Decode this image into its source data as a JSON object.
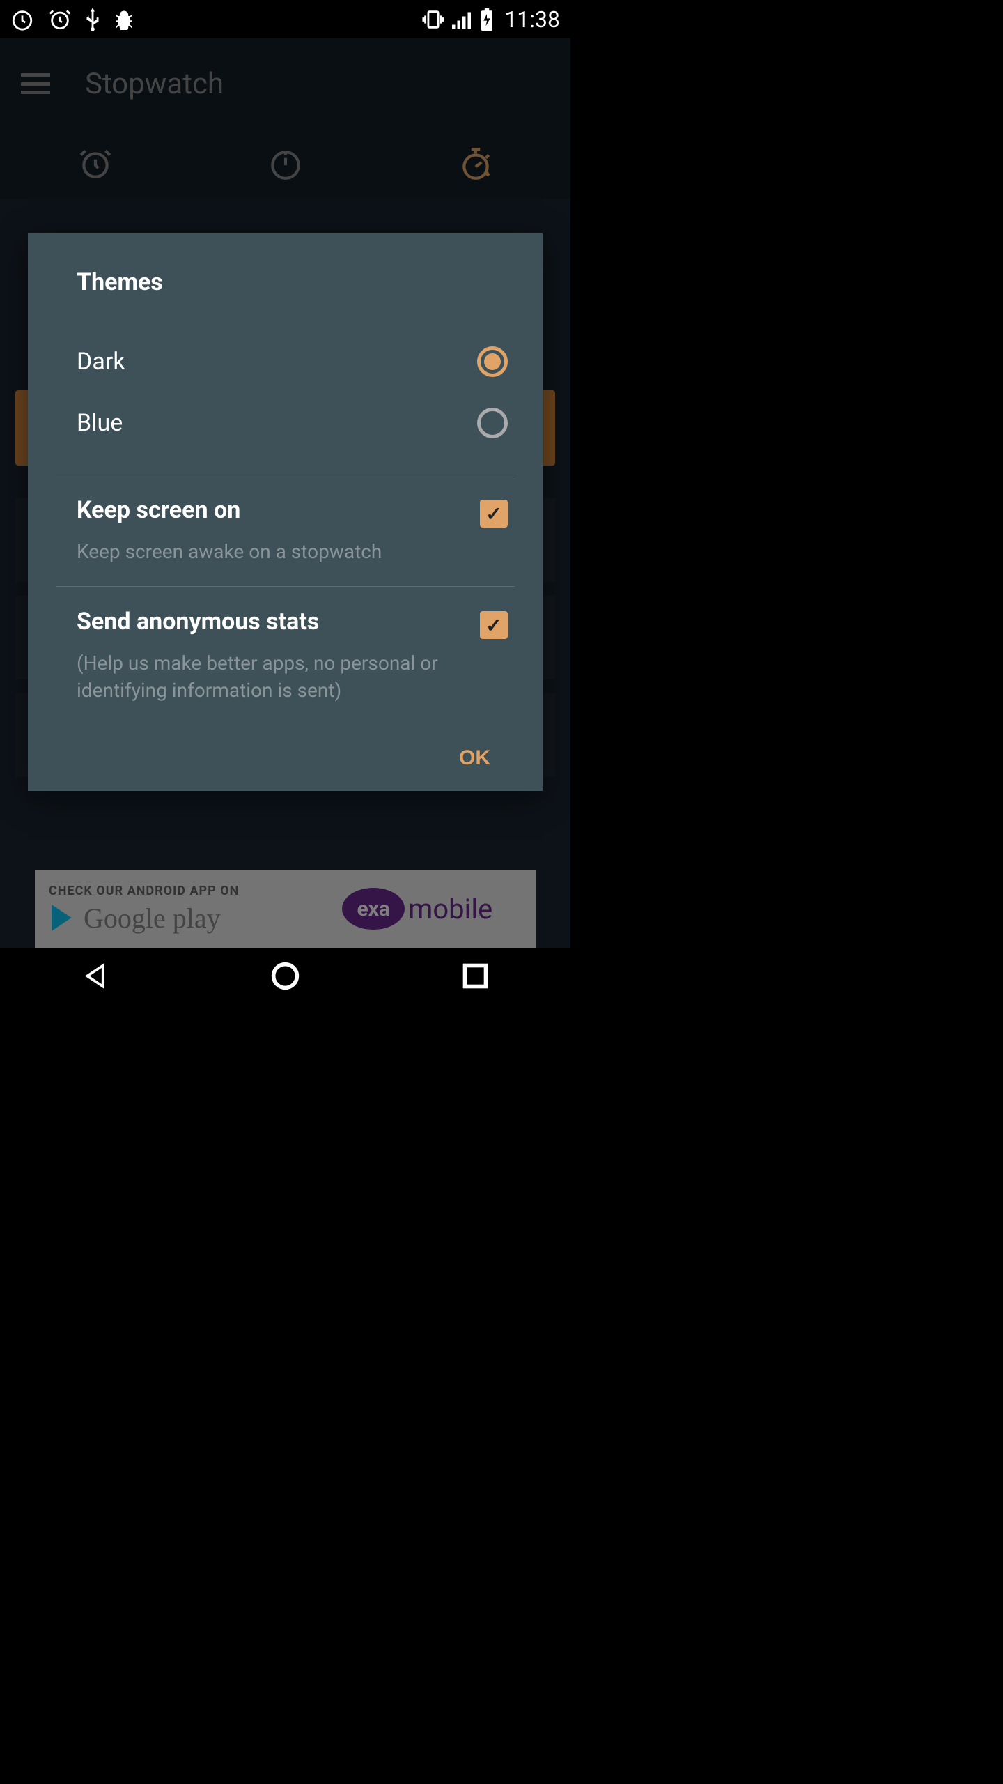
{
  "status_bar": {
    "time": "11:38"
  },
  "app": {
    "title": "Stopwatch"
  },
  "dialog": {
    "themes_title": "Themes",
    "theme_options": {
      "dark": "Dark",
      "blue": "Blue"
    },
    "keep_screen": {
      "title": "Keep screen on",
      "subtitle": "Keep screen awake on a stopwatch",
      "checked": true
    },
    "send_stats": {
      "title": "Send anonymous stats",
      "subtitle": "(Help us make better apps, no personal or identifying information is sent)",
      "checked": true
    },
    "ok_label": "OK"
  },
  "ad": {
    "check_text": "CHECK OUR ANDROID APP ON",
    "google_play": "Google play",
    "exa": "exa",
    "mobile": "mobile"
  },
  "colors": {
    "accent": "#e0a468",
    "dialog_bg": "#3e5159",
    "app_bg": "#1a2530",
    "header_bg": "#141e27"
  }
}
